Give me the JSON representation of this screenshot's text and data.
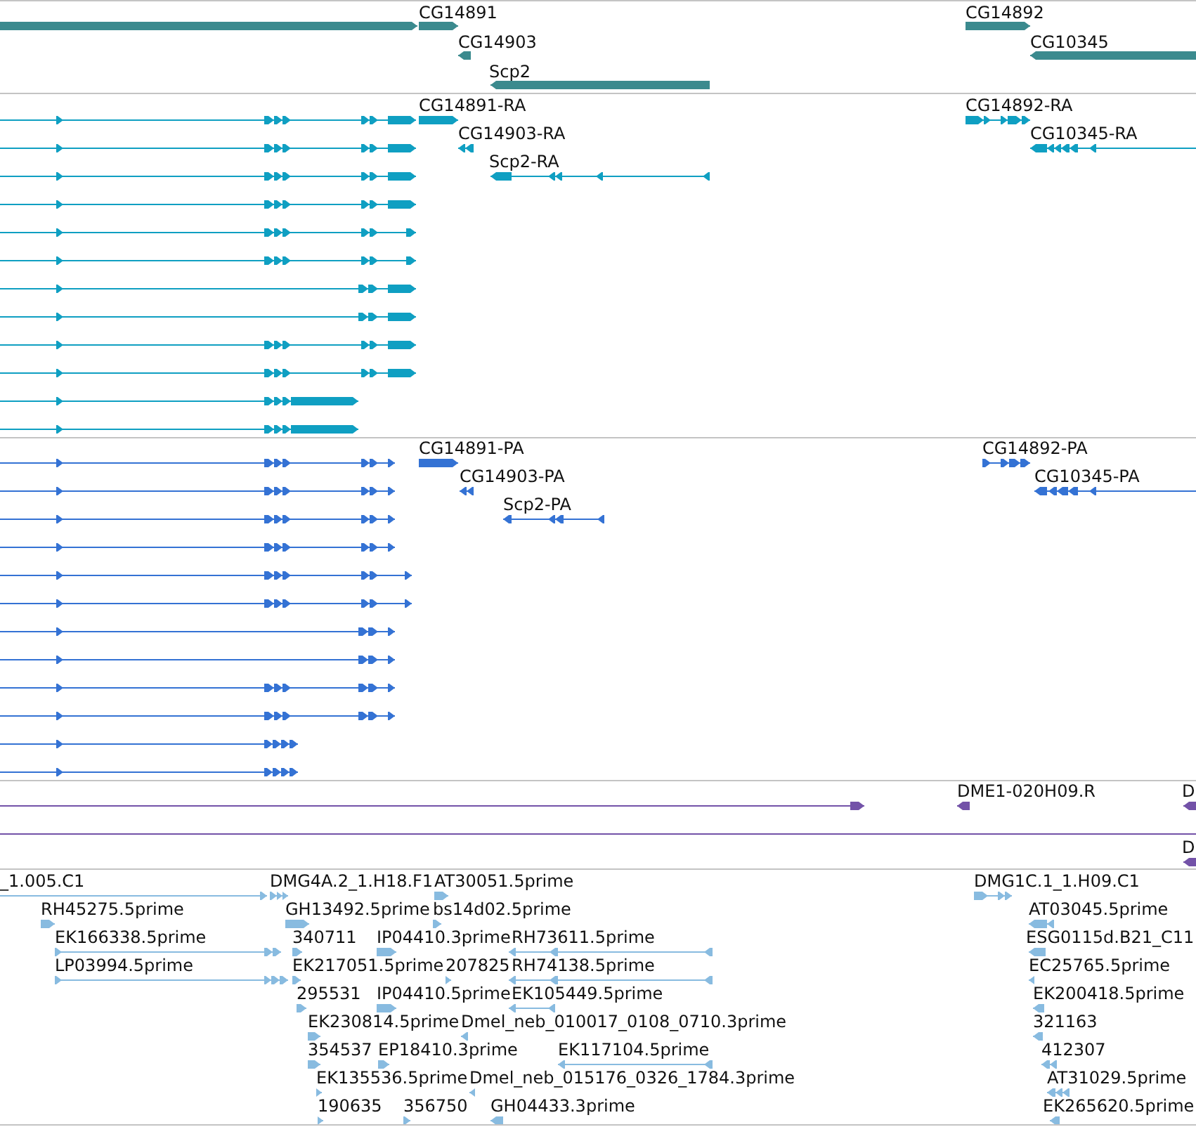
{
  "tracks": [
    {
      "color": "#3b8a8e",
      "features": [
        {
          "reverse": false
        },
        {
          "label": "CG14891",
          "reverse": false
        },
        {
          "label": "CG14892",
          "reverse": false
        },
        {
          "label": "CG14903",
          "reverse": true
        },
        {
          "label": "CG10345",
          "reverse": true
        },
        {
          "label": "Scp2",
          "reverse": true
        }
      ]
    },
    {
      "color": "#0f9fc2",
      "features": [
        {
          "reverse": false
        },
        {
          "label": "CG14891-RA",
          "reverse": false
        },
        {
          "label": "CG14892-RA",
          "reverse": false
        },
        {
          "reverse": false
        },
        {
          "label": "CG14903-RA",
          "reverse": true
        },
        {
          "label": "CG10345-RA",
          "reverse": true
        },
        {
          "reverse": false
        },
        {
          "label": "Scp2-RA",
          "reverse": true
        },
        {
          "reverse": false
        },
        {
          "reverse": false
        },
        {
          "reverse": false
        },
        {
          "reverse": false
        },
        {
          "reverse": false
        },
        {
          "reverse": false
        },
        {
          "reverse": false
        },
        {
          "reverse": false
        },
        {
          "reverse": false
        }
      ]
    },
    {
      "color": "#3472d4",
      "features": [
        {
          "reverse": false
        },
        {
          "label": "CG14891-PA",
          "reverse": false
        },
        {
          "label": "CG14892-PA",
          "reverse": false
        },
        {
          "reverse": false
        },
        {
          "label": "CG14903-PA",
          "reverse": true
        },
        {
          "label": "CG10345-PA",
          "reverse": true
        },
        {
          "reverse": false
        },
        {
          "label": "Scp2-PA",
          "reverse": true
        },
        {
          "reverse": false
        },
        {
          "reverse": false
        },
        {
          "reverse": false
        },
        {
          "reverse": false
        },
        {
          "reverse": false
        },
        {
          "reverse": false
        },
        {
          "reverse": false
        },
        {
          "reverse": false
        },
        {
          "reverse": false
        }
      ]
    },
    {
      "color": "#7352a8",
      "features": [
        {
          "kind": "arrow",
          "reverse": false
        },
        {
          "kind": "arrow",
          "label": "DME1-020H09.R",
          "reverse": true
        },
        {
          "kind": "arrow",
          "label": "D",
          "reverse": true
        },
        {
          "kind": "line"
        },
        {
          "kind": "arrow",
          "label": "D",
          "reverse": true
        }
      ]
    },
    {
      "color": "#88bbe0",
      "features": [
        {
          "label": "_1.005.C1",
          "reverse": false
        },
        {
          "label": "DMG4A.2_1.H18.F1",
          "reverse": false
        },
        {
          "label": "AT30051.5prime",
          "reverse": false
        },
        {
          "label": "DMG1C.1_1.H09.C1",
          "reverse": false
        },
        {
          "label": "RH45275.5prime",
          "reverse": false
        },
        {
          "label": "GH13492.5prime",
          "reverse": false
        },
        {
          "label": "bs14d02.5prime",
          "reverse": false
        },
        {
          "label": "AT03045.5prime",
          "reverse": true
        },
        {
          "label": "EK166338.5prime",
          "reverse": false
        },
        {
          "label": "340711",
          "reverse": false
        },
        {
          "label": "IP04410.3prime",
          "reverse": false
        },
        {
          "label": "RH73611.5prime",
          "reverse": true
        },
        {
          "label": "ESG0115d.B21_C11",
          "reverse": true
        },
        {
          "label": "LP03994.5prime",
          "reverse": false
        },
        {
          "label": "EK217051.5prime",
          "reverse": false
        },
        {
          "label": "207825",
          "reverse": false
        },
        {
          "label": "RH74138.5prime",
          "reverse": true
        },
        {
          "label": "EC25765.5prime",
          "reverse": true
        },
        {
          "label": "295531",
          "reverse": false
        },
        {
          "label": "IP04410.5prime",
          "reverse": false
        },
        {
          "label": "EK105449.5prime",
          "reverse": true
        },
        {
          "label": "EK200418.5prime",
          "reverse": true
        },
        {
          "label": "EK230814.5prime",
          "reverse": false
        },
        {
          "label": "Dmel_neb_010017_0108_0710.3prime",
          "reverse": true
        },
        {
          "label": "321163",
          "reverse": true
        },
        {
          "label": "354537",
          "reverse": false
        },
        {
          "label": "EP18410.3prime",
          "reverse": false
        },
        {
          "label": "EK117104.5prime",
          "reverse": true
        },
        {
          "label": "412307",
          "reverse": true
        },
        {
          "label": "EK135536.5prime",
          "reverse": false
        },
        {
          "label": "Dmel_neb_015176_0326_1784.3prime",
          "reverse": true
        },
        {
          "label": "AT31029.5prime",
          "reverse": true
        },
        {
          "label": "190635",
          "reverse": false
        },
        {
          "label": "356750",
          "reverse": false
        },
        {
          "label": "GH04433.3prime",
          "reverse": true
        },
        {
          "label": "EK265620.5prime",
          "reverse": true
        }
      ]
    }
  ]
}
